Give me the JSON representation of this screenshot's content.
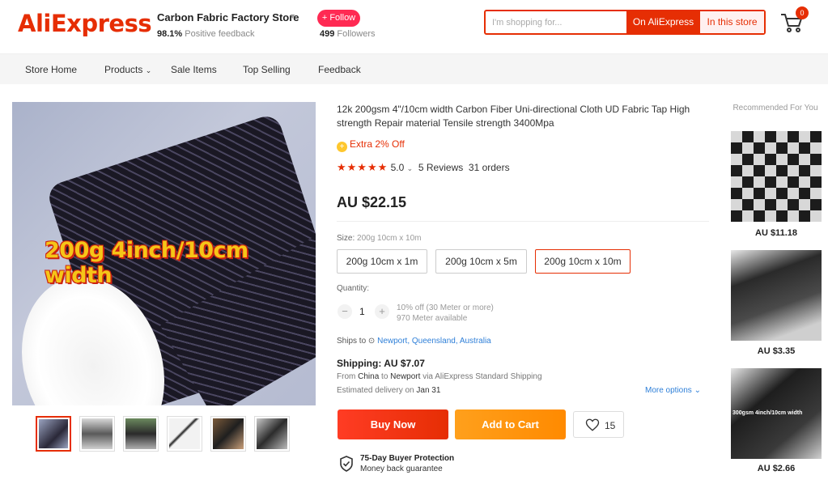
{
  "header": {
    "logo": "AliExpress",
    "store_name": "Carbon Fabric Factory Store",
    "feedback_pct": "98.1%",
    "feedback_label": "Positive feedback",
    "follow_label": "+ Follow",
    "followers_count": "499",
    "followers_label": "Followers",
    "search_placeholder": "I'm shopping for...",
    "search_ali_label": "On AliExpress",
    "search_store_label": "In this store",
    "cart_count": "0"
  },
  "nav": {
    "items": [
      "Store Home",
      "Products",
      "Sale Items",
      "Top Selling",
      "Feedback"
    ]
  },
  "gallery": {
    "image_caption": "200g 4inch/10cm width"
  },
  "product": {
    "title": "12k 200gsm 4\"/10cm width Carbon Fiber Uni-directional Cloth UD Fabric Tap High strength Repair material Tensile strength 3400Mpa",
    "extra_off": "Extra 2% Off",
    "rating": "5.0",
    "reviews": "5 Reviews",
    "orders": "31 orders",
    "price": "AU $22.15",
    "size_label": "Size:",
    "size_selected": "200g 10cm x 10m",
    "size_options": [
      "200g 10cm x 1m",
      "200g 10cm x 5m",
      "200g 10cm x 10m"
    ],
    "quantity_label": "Quantity:",
    "quantity": "1",
    "qty_discount": "10% off (30 Meter or more)",
    "qty_available": "970 Meter available",
    "ships_to_label": "Ships to",
    "ships_to_location": "Newport, Queensland, Australia",
    "shipping": "Shipping: AU $7.07",
    "ship_from_prefix": "From",
    "ship_from_country": "China",
    "ship_to_word": "to",
    "ship_to_city": "Newport",
    "ship_via": "via AliExpress Standard Shipping",
    "est_label": "Estimated delivery on",
    "est_date": "Jan 31",
    "more_options": "More options",
    "buy_label": "Buy Now",
    "cart_label": "Add to Cart",
    "wish_count": "15",
    "protection_title": "75-Day Buyer Protection",
    "protection_sub": "Money back guarantee"
  },
  "recommended": {
    "title": "Recommended For You",
    "items": [
      {
        "price": "AU $11.18"
      },
      {
        "price": "AU $3.35"
      },
      {
        "price": "AU $2.66",
        "img_text": "300gsm 4inch/10cm width"
      }
    ]
  },
  "colors": {
    "brand": "#e62e04",
    "follow": "#ff2a53",
    "cart_button": "#ff8a00",
    "link": "#2e7fd8"
  }
}
